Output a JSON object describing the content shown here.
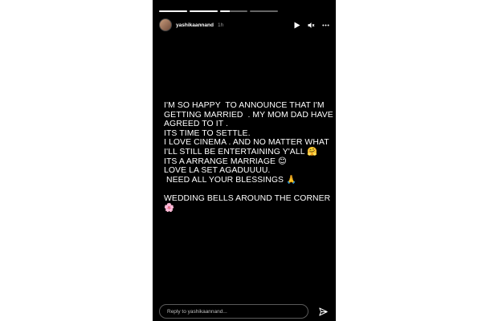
{
  "story": {
    "progress_segments": [
      {
        "fill": 1.0
      },
      {
        "fill": 1.0
      },
      {
        "fill": 0.35
      },
      {
        "fill": 0.0
      }
    ],
    "header": {
      "username": "yashikaannand",
      "time": "1h",
      "icons": [
        "play-icon",
        "volume-icon",
        "more-options-icon"
      ]
    },
    "caption_lines": [
      "I'M SO HAPPY  TO ANNOUNCE THAT I'M",
      "GETTING MARRIED  . MY MOM DAD HAVE",
      "AGREED TO IT .",
      "ITS TIME TO SETTLE.",
      "I LOVE CINEMA . AND NO MATTER WHAT",
      "I'LL STILL BE ENTERTAINING Y'ALL 🤗",
      "ITS A ARRANGE MARRIAGE 😊",
      "LOVE LA SET AGADUUUU.",
      " NEED ALL YOUR BLESSINGS 🙏",
      "",
      "WEDDING BELLS AROUND THE CORNER",
      "🌸"
    ],
    "footer": {
      "reply_placeholder": "Reply to yashikaannand...",
      "send_icon": "send-icon"
    },
    "colors": {
      "background": "#000000",
      "page": "#ffffff",
      "text": "#ffffff"
    }
  }
}
